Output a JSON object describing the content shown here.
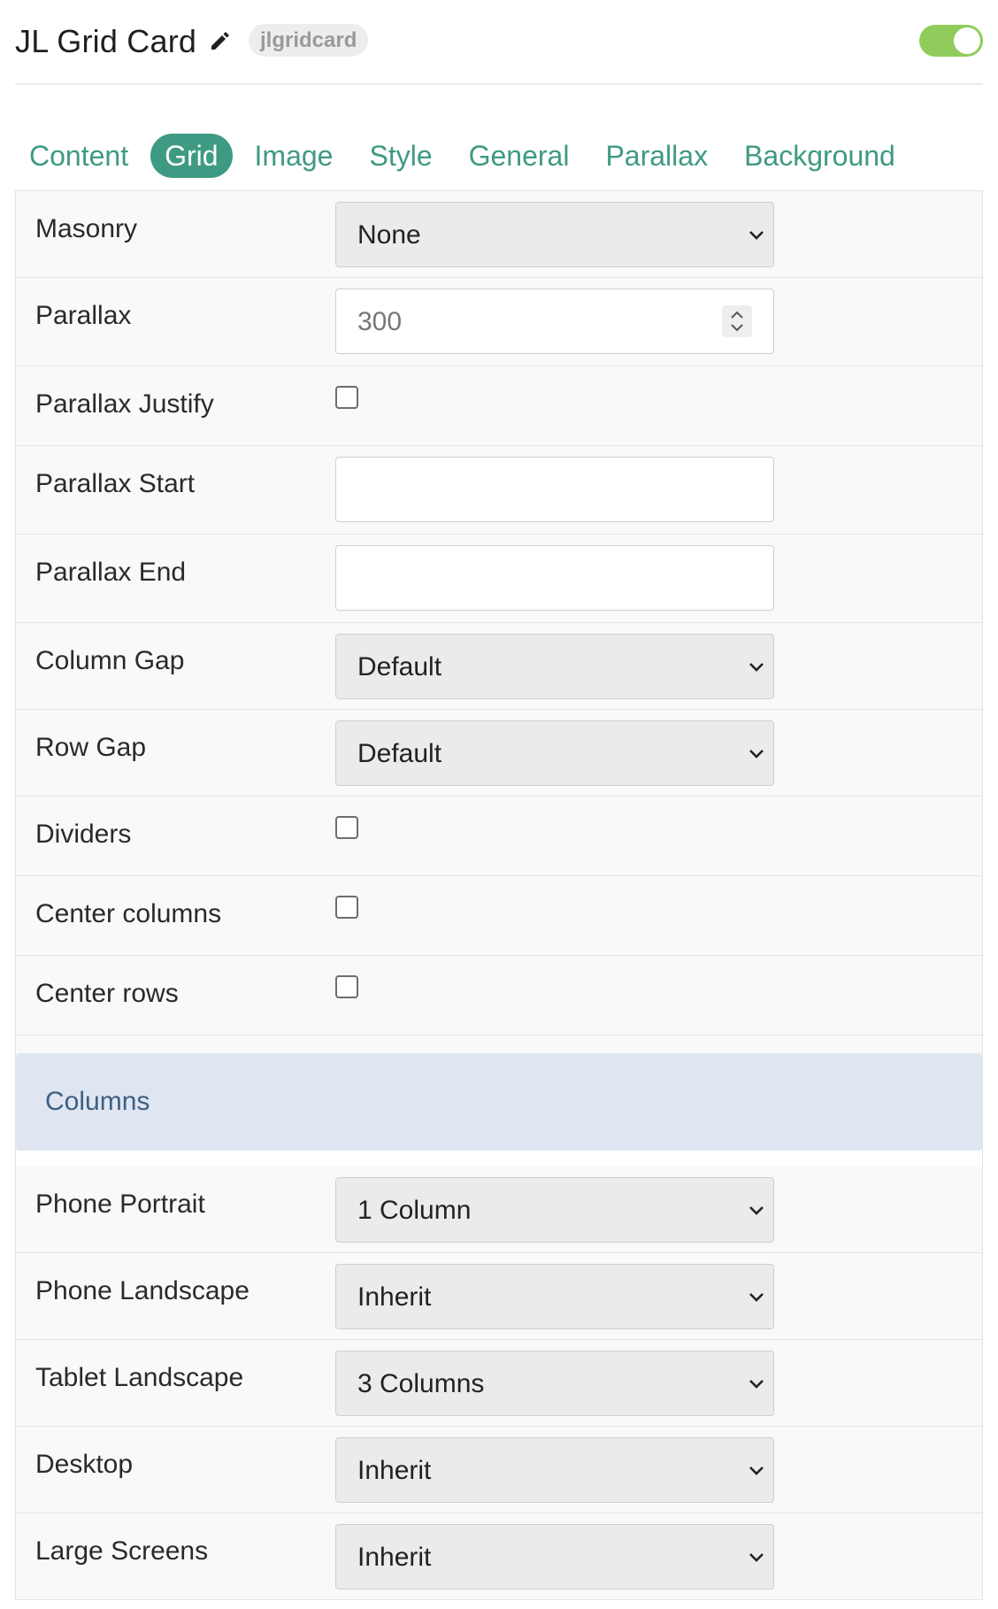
{
  "header": {
    "title": "JL Grid Card",
    "badge": "jlgridcard",
    "edit_icon": "pencil-icon",
    "toggle_on": true,
    "toggle_color": "#8fcc5c"
  },
  "tabs": [
    {
      "label": "Content",
      "active": false
    },
    {
      "label": "Grid",
      "active": true
    },
    {
      "label": "Image",
      "active": false
    },
    {
      "label": "Style",
      "active": false
    },
    {
      "label": "General",
      "active": false
    },
    {
      "label": "Parallax",
      "active": false
    },
    {
      "label": "Background",
      "active": false
    }
  ],
  "accent_color": "#3e9a82",
  "fields": {
    "masonry": {
      "label": "Masonry",
      "value": "None"
    },
    "parallax": {
      "label": "Parallax",
      "placeholder": "300"
    },
    "parallax_justify": {
      "label": "Parallax Justify",
      "checked": false
    },
    "parallax_start": {
      "label": "Parallax Start",
      "value": ""
    },
    "parallax_end": {
      "label": "Parallax End",
      "value": ""
    },
    "column_gap": {
      "label": "Column Gap",
      "value": "Default"
    },
    "row_gap": {
      "label": "Row Gap",
      "value": "Default"
    },
    "dividers": {
      "label": "Dividers",
      "checked": false
    },
    "center_columns": {
      "label": "Center columns",
      "checked": false
    },
    "center_rows": {
      "label": "Center rows",
      "checked": false
    }
  },
  "columns_section": {
    "title": "Columns",
    "fields": {
      "phone_portrait": {
        "label": "Phone Portrait",
        "value": "1 Column"
      },
      "phone_landscape": {
        "label": "Phone Landscape",
        "value": "Inherit"
      },
      "tablet_landscape": {
        "label": "Tablet Landscape",
        "value": "3 Columns"
      },
      "desktop": {
        "label": "Desktop",
        "value": "Inherit"
      },
      "large_screens": {
        "label": "Large Screens",
        "value": "Inherit"
      }
    }
  }
}
